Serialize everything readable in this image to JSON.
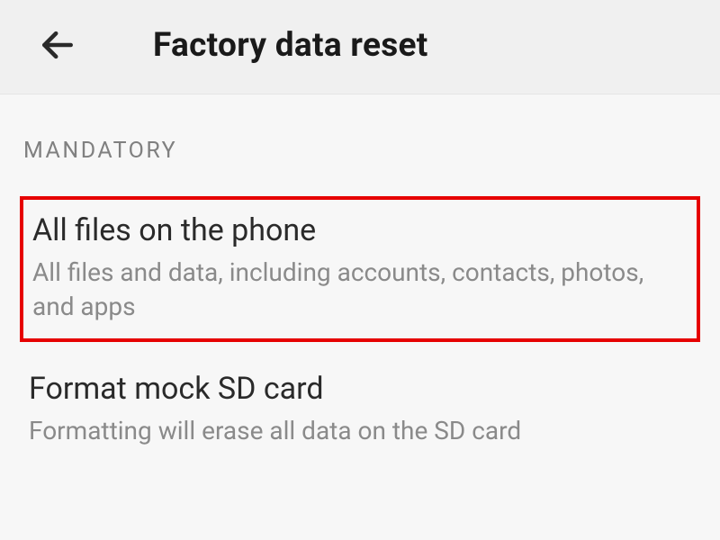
{
  "header": {
    "title": "Factory data reset"
  },
  "section_label": "MANDATORY",
  "options": [
    {
      "title": "All files on the phone",
      "description": "All files and data, including accounts, contacts, photos, and apps",
      "highlighted": true
    },
    {
      "title": "Format mock SD card",
      "description": "Formatting will erase all data on the SD card",
      "highlighted": false
    }
  ]
}
